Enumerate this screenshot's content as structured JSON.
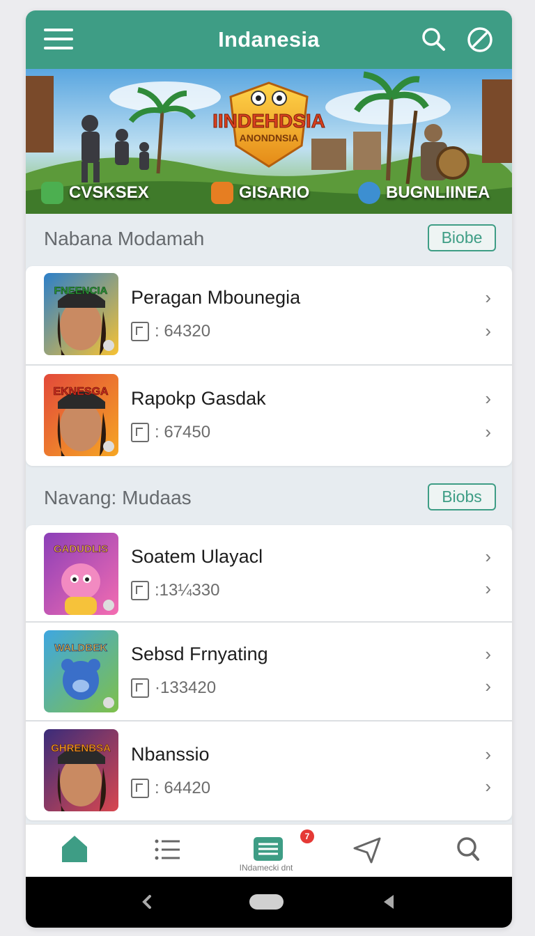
{
  "app": {
    "title": "Indanesia"
  },
  "banner": {
    "logo_line1": "IINDEHDSIA",
    "logo_line2": "ANONDNSIA",
    "chips": [
      {
        "label": "CVSKSEX",
        "icon": "gamepad-icon",
        "color": "#4caf50"
      },
      {
        "label": "GISARIO",
        "icon": "box-icon",
        "color": "#e67e22"
      },
      {
        "label": "BUGNLIINEA",
        "icon": "puzzle-icon",
        "color": "#3d8fd1"
      }
    ]
  },
  "sections": [
    {
      "title": "Nabana Modamah",
      "button": "Biobe",
      "items": [
        {
          "title": "Peragan Mbounegia",
          "meta": ": 64320",
          "thumb_text": "FNEENCIA",
          "thumb_colors": [
            "#2c7fc9",
            "#f7c233"
          ]
        },
        {
          "title": "Rapokp Gasdak",
          "meta": ": 67450",
          "thumb_text": "EKNESGA",
          "thumb_colors": [
            "#e2493a",
            "#f6a623"
          ]
        }
      ]
    },
    {
      "title": "Navang: Mudaas",
      "button": "Biobs",
      "items": [
        {
          "title": "Soatem Ulayacl",
          "meta": ":13¼330",
          "thumb_text": "GADUDLIS",
          "thumb_colors": [
            "#8b3fb8",
            "#f46db1"
          ]
        },
        {
          "title": "Sebsd Frnyating",
          "meta": "·133420",
          "thumb_text": "WALDBEK",
          "thumb_colors": [
            "#3fa7e0",
            "#7fc04a"
          ]
        },
        {
          "title": "Nbanssio",
          "meta": ": 64420",
          "thumb_text": "GHRENBSA",
          "thumb_colors": [
            "#3a2c7a",
            "#d8474f"
          ]
        }
      ]
    }
  ],
  "bottom_nav": {
    "caption": "INdamecki dnt",
    "badge": "7",
    "accent": "#3e9d85"
  }
}
